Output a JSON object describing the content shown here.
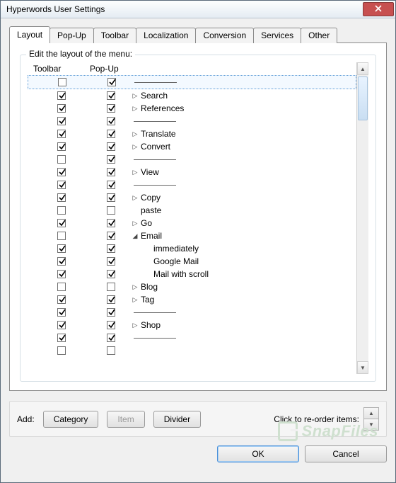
{
  "window": {
    "title": "Hyperwords User Settings"
  },
  "tabs": [
    {
      "label": "Layout",
      "active": true
    },
    {
      "label": "Pop-Up",
      "active": false
    },
    {
      "label": "Toolbar",
      "active": false
    },
    {
      "label": "Localization",
      "active": false
    },
    {
      "label": "Conversion",
      "active": false
    },
    {
      "label": "Services",
      "active": false
    },
    {
      "label": "Other",
      "active": false
    }
  ],
  "groupbox": {
    "title": "Edit the layout of the menu:"
  },
  "columns": {
    "toolbar": "Toolbar",
    "popup": "Pop-Up"
  },
  "rows": [
    {
      "toolbar": false,
      "popup": true,
      "type": "divider"
    },
    {
      "toolbar": true,
      "popup": true,
      "type": "item",
      "disclosure": "right",
      "label": "Search"
    },
    {
      "toolbar": true,
      "popup": true,
      "type": "item",
      "disclosure": "right",
      "label": "References"
    },
    {
      "toolbar": true,
      "popup": true,
      "type": "divider"
    },
    {
      "toolbar": true,
      "popup": true,
      "type": "item",
      "disclosure": "right",
      "label": "Translate"
    },
    {
      "toolbar": true,
      "popup": true,
      "type": "item",
      "disclosure": "right",
      "label": "Convert"
    },
    {
      "toolbar": false,
      "popup": true,
      "type": "divider"
    },
    {
      "toolbar": true,
      "popup": true,
      "type": "item",
      "disclosure": "right",
      "label": "View"
    },
    {
      "toolbar": true,
      "popup": true,
      "type": "divider"
    },
    {
      "toolbar": true,
      "popup": true,
      "type": "item",
      "disclosure": "right",
      "label": "Copy"
    },
    {
      "toolbar": false,
      "popup": false,
      "type": "item",
      "disclosure": "",
      "label": "paste"
    },
    {
      "toolbar": true,
      "popup": true,
      "type": "item",
      "disclosure": "right",
      "label": "Go"
    },
    {
      "toolbar": false,
      "popup": true,
      "type": "item",
      "disclosure": "down",
      "label": "Email"
    },
    {
      "toolbar": true,
      "popup": true,
      "type": "sub",
      "label": "immediately"
    },
    {
      "toolbar": true,
      "popup": true,
      "type": "sub",
      "label": "Google Mail"
    },
    {
      "toolbar": true,
      "popup": true,
      "type": "sub",
      "label": "Mail with scroll"
    },
    {
      "toolbar": false,
      "popup": false,
      "type": "item",
      "disclosure": "right",
      "label": "Blog"
    },
    {
      "toolbar": true,
      "popup": true,
      "type": "item",
      "disclosure": "right",
      "label": "Tag"
    },
    {
      "toolbar": true,
      "popup": true,
      "type": "divider"
    },
    {
      "toolbar": true,
      "popup": true,
      "type": "item",
      "disclosure": "right",
      "label": "Shop"
    },
    {
      "toolbar": true,
      "popup": true,
      "type": "divider"
    },
    {
      "toolbar": false,
      "popup": false,
      "type": "blank"
    }
  ],
  "addbar": {
    "label": "Add:",
    "category": "Category",
    "item": "Item",
    "divider": "Divider",
    "reorder_label": "Click to re-order items:"
  },
  "buttons": {
    "ok": "OK",
    "cancel": "Cancel"
  },
  "watermark": "SnapFiles"
}
